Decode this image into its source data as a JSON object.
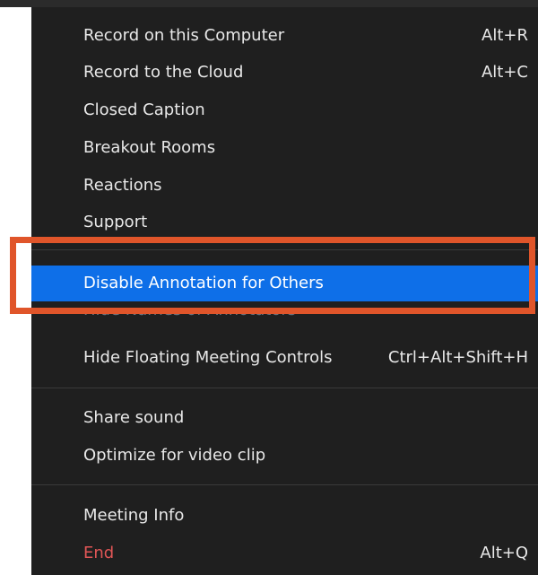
{
  "menu": {
    "items": [
      {
        "label": "Record on this Computer",
        "shortcut": "Alt+R"
      },
      {
        "label": "Record to the Cloud",
        "shortcut": "Alt+C"
      },
      {
        "label": "Closed Caption",
        "shortcut": ""
      },
      {
        "label": "Breakout Rooms",
        "shortcut": ""
      },
      {
        "label": "Reactions",
        "shortcut": ""
      },
      {
        "label": "Support",
        "shortcut": ""
      },
      {
        "label": "Disable Annotation for Others",
        "shortcut": ""
      },
      {
        "label": "Hide Names of Annotators",
        "shortcut": ""
      },
      {
        "label": "Hide Floating Meeting Controls",
        "shortcut": "Ctrl+Alt+Shift+H"
      },
      {
        "label": "Share sound",
        "shortcut": ""
      },
      {
        "label": "Optimize for video clip",
        "shortcut": ""
      },
      {
        "label": "Meeting Info",
        "shortcut": ""
      },
      {
        "label": "End",
        "shortcut": "Alt+Q"
      }
    ]
  },
  "colors": {
    "menu_background": "#1f1f1f",
    "selected_background": "#0e6fe8",
    "highlight_border": "#e0552a",
    "end_text": "#e05656"
  }
}
